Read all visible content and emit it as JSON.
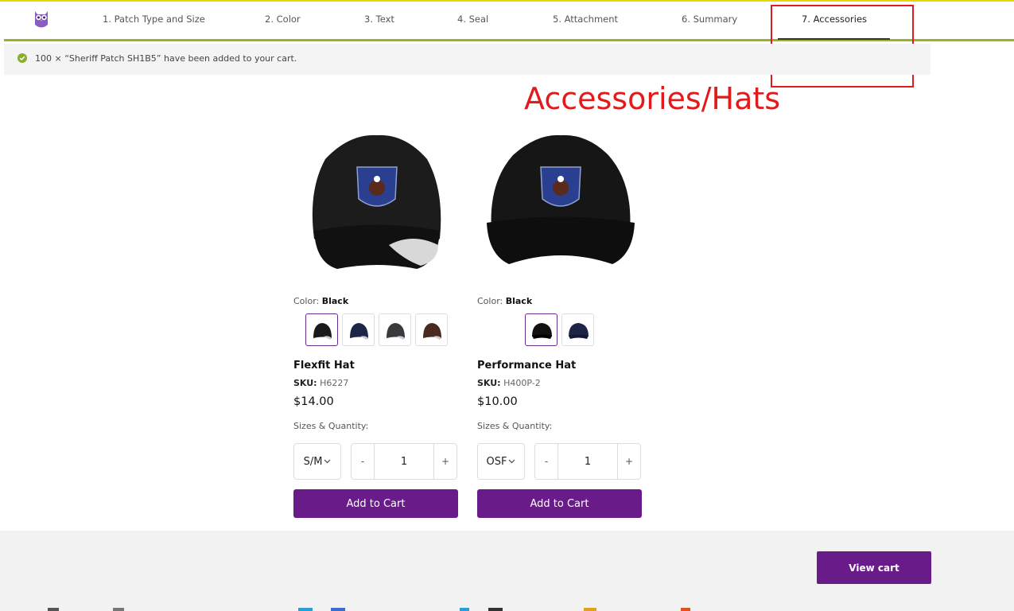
{
  "nav": {
    "steps": [
      {
        "label": "1. Patch Type and Size"
      },
      {
        "label": "2. Color"
      },
      {
        "label": "3. Text"
      },
      {
        "label": "4. Seal"
      },
      {
        "label": "5. Attachment"
      },
      {
        "label": "6. Summary"
      },
      {
        "label": "7. Accessories"
      }
    ],
    "active_step": "7. Accessories"
  },
  "notice": {
    "text": "100 × “Sheriff Patch SH1B5” have been added to your cart."
  },
  "annotation": {
    "text": "Accessories/Hats",
    "color": "#e11b1b"
  },
  "products": [
    {
      "color_label": "Color:",
      "color_value": "Black",
      "swatches": [
        "Black",
        "Navy",
        "Charcoal",
        "Brown"
      ],
      "name": "Flexfit Hat",
      "sku_label": "SKU:",
      "sku": "H6227",
      "price": "$14.00",
      "sizes_label": "Sizes & Quantity:",
      "size": "S/M",
      "qty_minus": "-",
      "qty": "1",
      "qty_plus": "+",
      "add_label": "Add to Cart"
    },
    {
      "color_label": "Color:",
      "color_value": "Black",
      "swatches": [
        "Black",
        "Navy"
      ],
      "name": "Performance Hat",
      "sku_label": "SKU:",
      "sku": "H400P-2",
      "price": "$10.00",
      "sizes_label": "Sizes & Quantity:",
      "size": "OSF",
      "qty_minus": "-",
      "qty": "1",
      "qty_plus": "+",
      "add_label": "Add to Cart"
    }
  ],
  "footer": {
    "view_cart_label": "View cart"
  },
  "colors": {
    "accent": "#6a1b8a",
    "nav_border": "#9bb425",
    "top_line": "#e8d600"
  }
}
